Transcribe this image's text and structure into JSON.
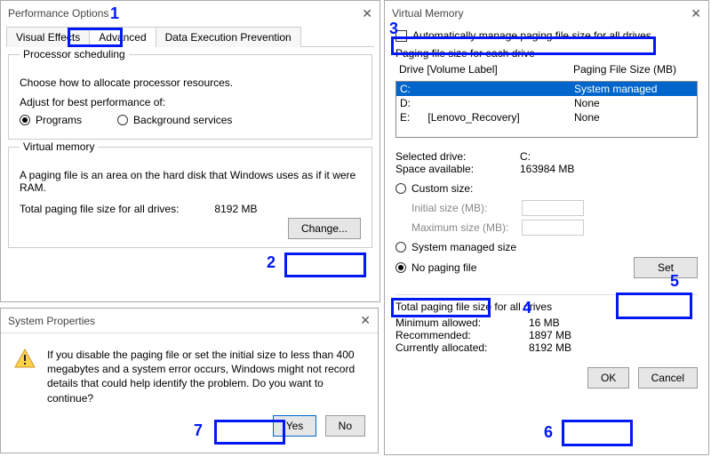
{
  "perf": {
    "title": "Performance Options",
    "tabs": {
      "t1": "Visual Effects",
      "t2": "Advanced",
      "t3": "Data Execution Prevention"
    },
    "sched": {
      "legend": "Processor scheduling",
      "line1": "Choose how to allocate processor resources.",
      "line2": "Adjust for best performance of:",
      "r1": "Programs",
      "r2": "Background services"
    },
    "vm": {
      "legend": "Virtual memory",
      "line1": "A paging file is an area on the hard disk that Windows uses as if it were RAM.",
      "totalLabel": "Total paging file size for all drives:",
      "totalValue": "8192 MB",
      "change": "Change..."
    }
  },
  "sys": {
    "title": "System Properties",
    "msg": "If you disable the paging file or set the initial size to less than 400 megabytes and a system error occurs, Windows might not record details that could help identify the problem. Do you want to continue?",
    "yes": "Yes",
    "no": "No"
  },
  "vmem": {
    "title": "Virtual Memory",
    "auto": "Automatically manage paging file size for all drives",
    "pf_legend": "Paging file size for each drive",
    "col1": "Drive  [Volume Label]",
    "col2": "Paging File Size (MB)",
    "drives": [
      {
        "letter": "C:",
        "label": "",
        "size": "System managed"
      },
      {
        "letter": "D:",
        "label": "",
        "size": "None"
      },
      {
        "letter": "E:",
        "label": "[Lenovo_Recovery]",
        "size": "None"
      }
    ],
    "selDriveLabel": "Selected drive:",
    "selDriveVal": "C:",
    "spaceLabel": "Space available:",
    "spaceVal": "163984 MB",
    "rCustom": "Custom size:",
    "initLabel": "Initial size (MB):",
    "maxLabel": "Maximum size (MB):",
    "rSys": "System managed size",
    "rNone": "No paging file",
    "set": "Set",
    "totalLegend": "Total paging file size for all drives",
    "minLabel": "Minimum allowed:",
    "minVal": "16 MB",
    "recLabel": "Recommended:",
    "recVal": "1897 MB",
    "curLabel": "Currently allocated:",
    "curVal": "8192 MB",
    "ok": "OK",
    "cancel": "Cancel"
  },
  "annot": {
    "n1": "1",
    "n2": "2",
    "n3": "3",
    "n4": "4",
    "n5": "5",
    "n6": "6",
    "n7": "7"
  }
}
